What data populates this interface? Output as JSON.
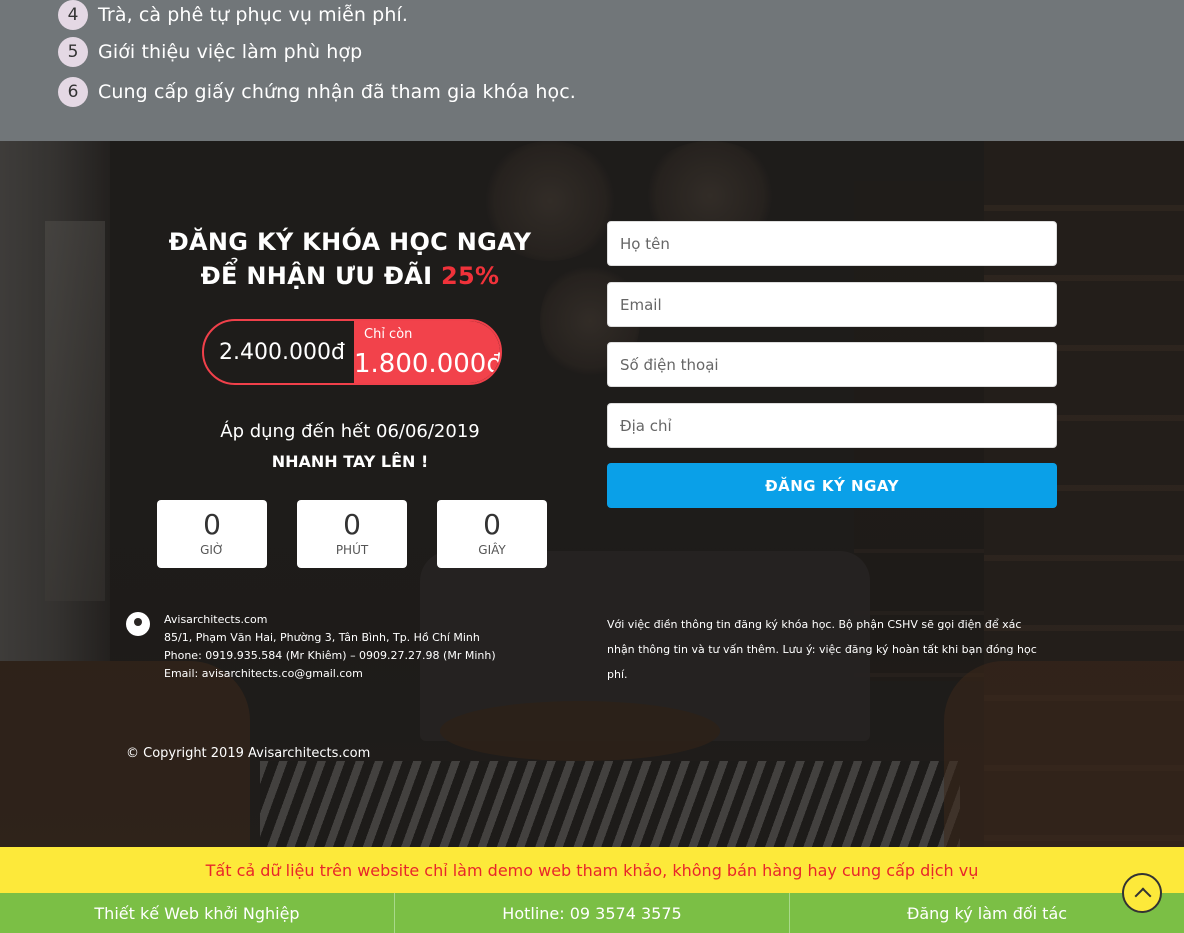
{
  "benefits": [
    {
      "num": "4",
      "text": "Trà, cà phê tự phục vụ miễn phí."
    },
    {
      "num": "5",
      "text": "Giới thiệu việc làm phù hợp"
    },
    {
      "num": "6",
      "text": "Cung cấp giấy chứng nhận đã tham gia khóa học."
    }
  ],
  "promo": {
    "line1": "ĐĂNG KÝ KHÓA HỌC NGAY",
    "line2": "ĐỂ NHẬN ƯU ĐÃI",
    "discount": "25%",
    "old_price": "2.400.000đ",
    "new_price_label": "Chỉ còn",
    "new_price": "1.800.000đ",
    "apply_until": "Áp dụng đến hết 06/06/2019",
    "hurry": "NHANH TAY LÊN !"
  },
  "countdown": [
    {
      "value": "0",
      "unit": "GIỜ"
    },
    {
      "value": "0",
      "unit": "PHÚT"
    },
    {
      "value": "0",
      "unit": "GIÂY"
    }
  ],
  "form": {
    "name_placeholder": "Họ tên",
    "email_placeholder": "Email",
    "phone_placeholder": "Số điện thoại",
    "address_placeholder": "Địa chỉ",
    "submit_label": "ĐĂNG KÝ NGAY"
  },
  "contact": {
    "site": "Avisarchitects.com",
    "address": "85/1, Phạm Văn Hai, Phường 3, Tân Bình, Tp. Hồ Chí Minh",
    "phone": "Phone: 0919.935.584 (Mr Khiêm) – 0909.27.27.98 (Mr Minh)",
    "email": "Email: avisarchitects.co@gmail.com"
  },
  "note": "Với việc điền thông tin đăng ký khóa học. Bộ phận CSHV sẽ gọi điện để xác nhận thông tin và tư vấn thêm. Lưu ý: việc đăng ký hoàn tất khi bạn đóng học phí.",
  "copyright": "© Copyright 2019 Avisarchitects.com",
  "demo_notice": "Tất cả dữ liệu trên website chỉ làm demo web tham khảo, không bán hàng hay cung cấp dịch vụ",
  "bottom_bar": {
    "item1": "Thiết kế Web khởi Nghiệp",
    "item2": "Hotline: 09 3574 3575",
    "item3": "Đăng ký làm đối tác"
  },
  "colors": {
    "accent_red": "#f0323a",
    "button_blue": "#0aa0e8",
    "notice_yellow": "#fde93a",
    "bar_green": "#7bbf45"
  }
}
